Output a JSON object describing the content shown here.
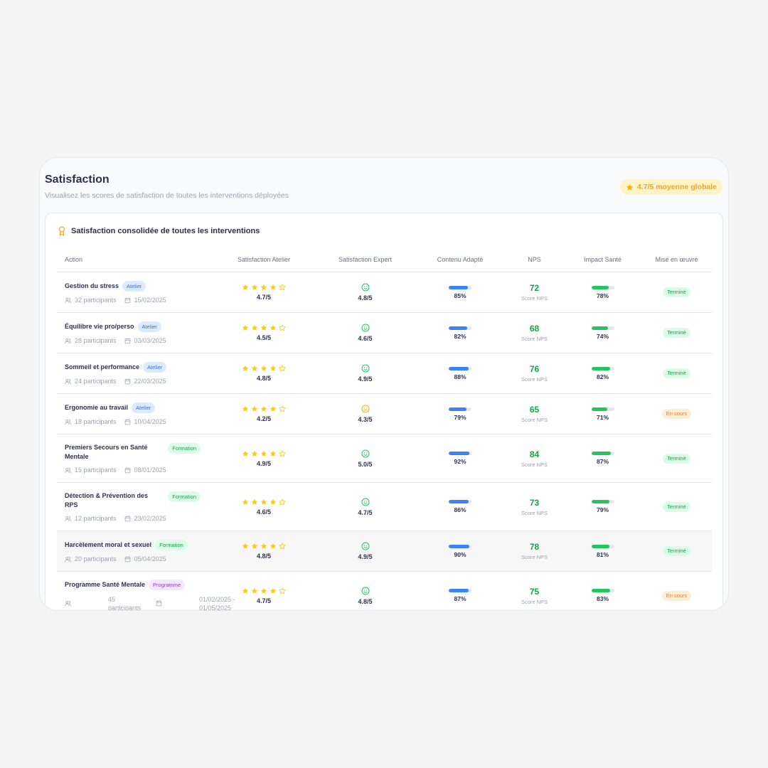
{
  "header": {
    "title": "Satisfaction",
    "subtitle": "Visualisez les scores de satisfaction de toutes les interventions déployées",
    "global_badge": "4.7/5 moyenne globale"
  },
  "card": {
    "title": "Satisfaction consolidée de toutes les interventions"
  },
  "table": {
    "columns": [
      "Action",
      "Satisfaction Atelier",
      "Satisfaction Expert",
      "Contenu Adapté",
      "NPS",
      "Impact Santé",
      "Mise en œuvre"
    ],
    "nps_label": "Score NPS",
    "rows": [
      {
        "name": "Gestion du stress",
        "tag": "Atelier",
        "tag_type": "atelier",
        "participants": "32 participants",
        "date": "15/02/2025",
        "workshop_rating": 4.7,
        "workshop_score": "4.7/5",
        "expert_score": "4.8/5",
        "expert_mood": "happy",
        "content_pct": "85%",
        "content_value": 85,
        "nps": "72",
        "health_pct": "78%",
        "health_value": 78,
        "status": "Terminé",
        "status_type": "done"
      },
      {
        "name": "Équilibre vie pro/perso",
        "tag": "Atelier",
        "tag_type": "atelier",
        "participants": "28 participants",
        "date": "03/03/2025",
        "workshop_rating": 4.5,
        "workshop_score": "4.5/5",
        "expert_score": "4.6/5",
        "expert_mood": "happy",
        "content_pct": "82%",
        "content_value": 82,
        "nps": "68",
        "health_pct": "74%",
        "health_value": 74,
        "status": "Terminé",
        "status_type": "done"
      },
      {
        "name": "Sommeil et performance",
        "tag": "Atelier",
        "tag_type": "atelier",
        "participants": "24 participants",
        "date": "22/03/2025",
        "workshop_rating": 4.8,
        "workshop_score": "4.8/5",
        "expert_score": "4.9/5",
        "expert_mood": "happy",
        "content_pct": "88%",
        "content_value": 88,
        "nps": "76",
        "health_pct": "82%",
        "health_value": 82,
        "status": "Terminé",
        "status_type": "done"
      },
      {
        "name": "Ergonomie au travail",
        "tag": "Atelier",
        "tag_type": "atelier",
        "participants": "18 participants",
        "date": "10/04/2025",
        "workshop_rating": 4.2,
        "workshop_score": "4.2/5",
        "expert_score": "4.3/5",
        "expert_mood": "neutral",
        "content_pct": "79%",
        "content_value": 79,
        "nps": "65",
        "health_pct": "71%",
        "health_value": 71,
        "status": "En cours",
        "status_type": "progress"
      },
      {
        "name": "Premiers Secours en Santé Mentale",
        "tag": "Formation",
        "tag_type": "formation",
        "participants": "15 participants",
        "date": "08/01/2025",
        "workshop_rating": 4.9,
        "workshop_score": "4.9/5",
        "expert_score": "5.0/5",
        "expert_mood": "happy",
        "content_pct": "92%",
        "content_value": 92,
        "nps": "84",
        "health_pct": "87%",
        "health_value": 87,
        "status": "Terminé",
        "status_type": "done"
      },
      {
        "name": "Détection & Prévention des RPS",
        "tag": "Formation",
        "tag_type": "formation",
        "participants": "12 participants",
        "date": "23/02/2025",
        "workshop_rating": 4.6,
        "workshop_score": "4.6/5",
        "expert_score": "4.7/5",
        "expert_mood": "happy",
        "content_pct": "86%",
        "content_value": 86,
        "nps": "73",
        "health_pct": "79%",
        "health_value": 79,
        "status": "Terminé",
        "status_type": "done"
      },
      {
        "name": "Harcèlement moral et sexuel",
        "tag": "Formation",
        "tag_type": "formation",
        "participants": "20 participants",
        "date": "05/04/2025",
        "workshop_rating": 4.8,
        "workshop_score": "4.8/5",
        "expert_score": "4.9/5",
        "expert_mood": "happy",
        "content_pct": "90%",
        "content_value": 90,
        "nps": "78",
        "health_pct": "81%",
        "health_value": 81,
        "status": "Terminé",
        "status_type": "done"
      },
      {
        "name": "Programme Santé Mentale",
        "tag": "Programme",
        "tag_type": "programme",
        "participants": "45 participants",
        "date": "01/02/2025 - 01/05/2025",
        "workshop_rating": 4.7,
        "workshop_score": "4.7/5",
        "expert_score": "4.8/5",
        "expert_mood": "happy",
        "content_pct": "87%",
        "content_value": 87,
        "nps": "75",
        "health_pct": "83%",
        "health_value": 83,
        "status": "En cours",
        "status_type": "progress"
      }
    ]
  },
  "colors": {
    "star_gold": "#facc15",
    "happy_green": "#22c55e",
    "neutral_amber": "#eab308",
    "content_blue": "#3b82f6",
    "health_green": "#22c55e",
    "nps_green": "#16a34a"
  },
  "icons": {
    "global_badge": "star-icon",
    "card_header": "award-icon",
    "participants": "users-icon",
    "date": "calendar-icon",
    "expert": "smiley-icon"
  }
}
